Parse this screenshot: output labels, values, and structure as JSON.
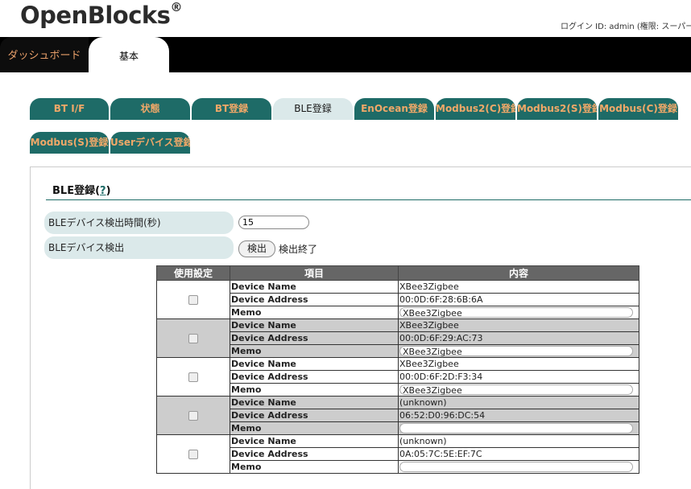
{
  "brand": {
    "name": "OpenBlocks",
    "mark": "®"
  },
  "login_text": "ログイン ID: admin (権限: スーパーユ",
  "top_tabs": [
    "ダッシュボード",
    "基本"
  ],
  "sub_tabs": [
    "BT I/F",
    "状態",
    "BT登録",
    "BLE登録",
    "EnOcean登録",
    "Modbus2(C)登録",
    "Modbus2(S)登録",
    "Modbus(C)登録",
    "Modbus(S)登録",
    "Userデバイス登録"
  ],
  "active_tab": "BLE登録",
  "section": {
    "title": "BLE登録(",
    "help": "?",
    "title_end": ")"
  },
  "fields": {
    "detect_time_label": "BLEデバイス検出時間(秒)",
    "detect_time_value": "15",
    "detect_label": "BLEデバイス検出",
    "detect_button": "検出",
    "detect_status": "検出終了"
  },
  "table": {
    "headers": [
      "使用設定",
      "項目",
      "内容"
    ],
    "row_keys": [
      "Device Name",
      "Device Address",
      "Memo"
    ],
    "devices": [
      {
        "name": "XBee3Zigbee",
        "address": "00:0D:6F:28:6B:6A",
        "memo": "XBee3Zigbee"
      },
      {
        "name": "XBee3Zigbee",
        "address": "00:0D:6F:29:AC:73",
        "memo": "XBee3Zigbee"
      },
      {
        "name": "XBee3Zigbee",
        "address": "00:0D:6F:2D:F3:34",
        "memo": "XBee3Zigbee"
      },
      {
        "name": "(unknown)",
        "address": "06:52:D0:96:DC:54",
        "memo": ""
      },
      {
        "name": "(unknown)",
        "address": "0A:05:7C:5E:EF:7C",
        "memo": ""
      }
    ]
  },
  "colors": {
    "tab_bg": "#1e6b67",
    "tab_text": "#f0a868",
    "active_tab_bg": "#dbe9ea",
    "header_bg": "#666666",
    "alt_row": "#cdcdcd"
  }
}
